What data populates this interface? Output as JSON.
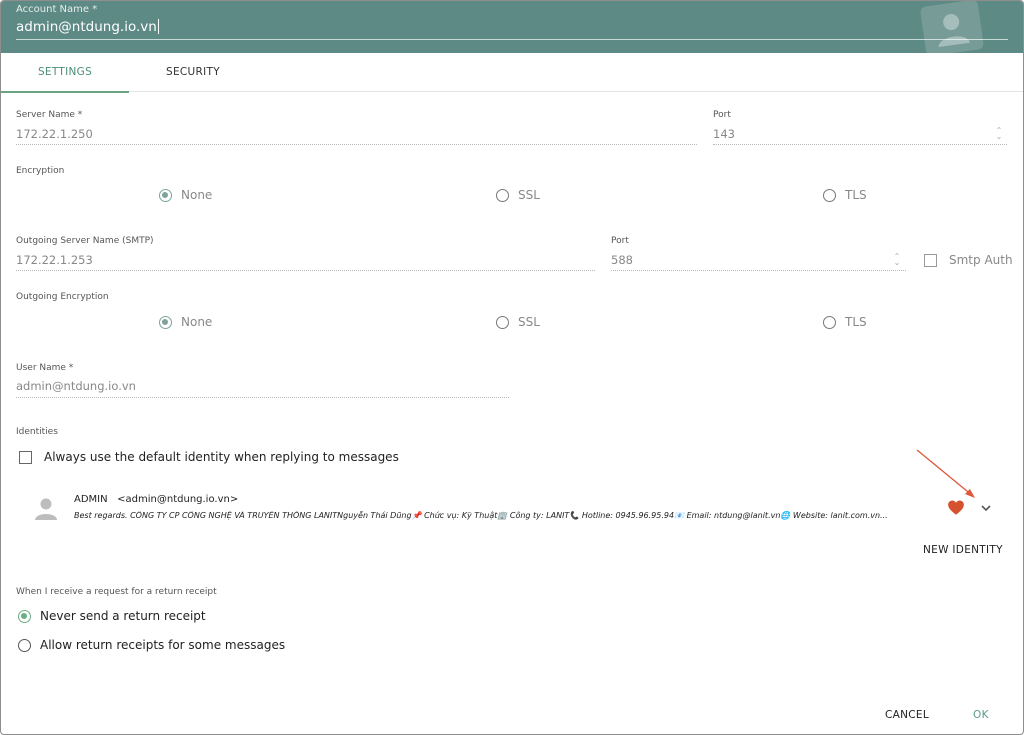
{
  "header": {
    "account_name_label": "Account Name",
    "account_name_value": "admin@ntdung.io.vn"
  },
  "tabs": [
    {
      "label": "SETTINGS",
      "active": true
    },
    {
      "label": "SECURITY",
      "active": false
    }
  ],
  "incoming": {
    "server_name_label": "Server Name",
    "server_name_value": "172.22.1.250",
    "port_label": "Port",
    "port_value": "143",
    "encryption_label": "Encryption",
    "encryption_options": [
      "None",
      "SSL",
      "TLS"
    ],
    "encryption_selected": "None"
  },
  "outgoing": {
    "server_name_label": "Outgoing Server Name (SMTP)",
    "server_name_value": "172.22.1.253",
    "port_label": "Port",
    "port_value": "588",
    "smtp_auth_label": "Smtp Auth",
    "encryption_label": "Outgoing Encryption",
    "encryption_options": [
      "None",
      "SSL",
      "TLS"
    ],
    "encryption_selected": "None"
  },
  "user": {
    "user_name_label": "User Name",
    "user_name_value": "admin@ntdung.io.vn"
  },
  "identities": {
    "section_label": "Identities",
    "default_identity_checkbox_label": "Always use the default identity when replying to messages",
    "items": [
      {
        "name": "ADMIN",
        "email": "<admin@ntdung.io.vn>",
        "signature": "Best regards. CÔNG TY CP CÔNG NGHỆ VÀ TRUYỀN THÔNG LANITNguyễn Thái Dũng📌 Chức vụ: Kỹ Thuật🏢 Công ty: LANIT📞 Hotline: 0945.96.95.94📧 Email: ntdung@lanit.vn🌐 Website: lanit.com.vn..."
      }
    ],
    "new_identity_label": "NEW IDENTITY"
  },
  "return_receipt": {
    "section_label": "When I receive a request for a return receipt",
    "options": [
      "Never send a return receipt",
      "Allow return receipts for some messages"
    ],
    "selected": "Never send a return receipt"
  },
  "footer": {
    "cancel_label": "CANCEL",
    "ok_label": "OK"
  },
  "colors": {
    "header_bg": "#5d8a84",
    "accent": "#4d8c7a",
    "radio_selected": "#7da39a",
    "heart": "#d4522f",
    "annotation_arrow": "#e0573a"
  },
  "icons": {
    "account_avatar": "contact-card-icon",
    "identity_avatar": "person-icon",
    "favorite": "heart-icon",
    "expand": "chevron-down-icon"
  }
}
